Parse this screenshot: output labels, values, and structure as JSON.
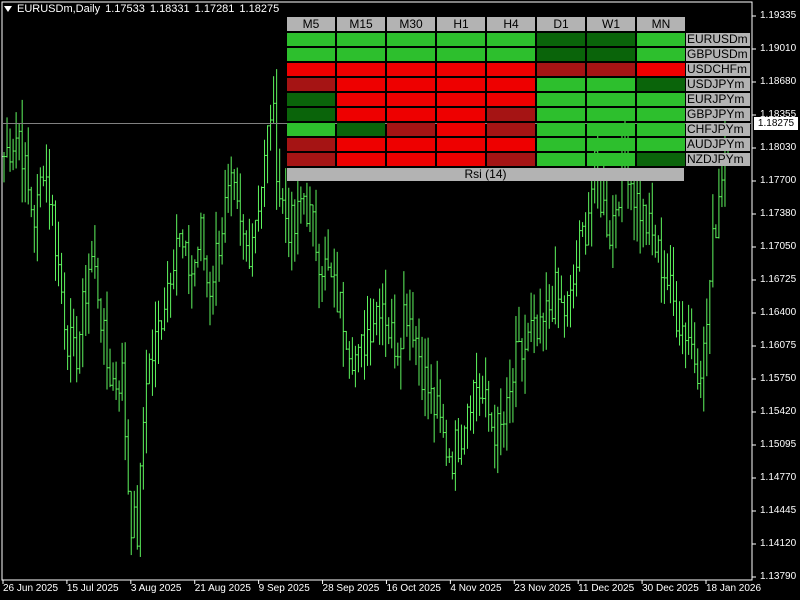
{
  "header": {
    "symbol_tf": "EURUSDm,Daily",
    "open": "1.17533",
    "high": "1.18331",
    "low": "1.17281",
    "close": "1.18275"
  },
  "y_axis": {
    "labels": [
      "1.19335",
      "1.19010",
      "1.18680",
      "1.18355",
      "1.18030",
      "1.17700",
      "1.17380",
      "1.17050",
      "1.16725",
      "1.16400",
      "1.16075",
      "1.15750",
      "1.15420",
      "1.15095",
      "1.14770",
      "1.14445",
      "1.14120",
      "1.13790"
    ],
    "range": [
      1.1379,
      1.19335
    ],
    "current_price": "1.18275",
    "current_price_value": 1.18275
  },
  "x_axis": {
    "labels": [
      "26 Jun 2025",
      "15 Jul 2025",
      "3 Aug 2025",
      "21 Aug 2025",
      "9 Sep 2025",
      "28 Sep 2025",
      "16 Oct 2025",
      "4 Nov 2025",
      "23 Nov 2025",
      "11 Dec 2025",
      "30 Dec 2025",
      "18 Jan 2026"
    ]
  },
  "indicator": {
    "timeframes": [
      "M5",
      "M15",
      "M30",
      "H1",
      "H4",
      "D1",
      "W1",
      "MN"
    ],
    "footer": "Rsi (14)",
    "colors": {
      "G": "#2dbf2d",
      "D": "#0a640a",
      "R": "#ee0000",
      "M": "#a51414"
    },
    "rows": [
      {
        "pair": "EURUSDm",
        "cells": [
          "G",
          "G",
          "G",
          "G",
          "G",
          "D",
          "D",
          "G"
        ]
      },
      {
        "pair": "GBPUSDm",
        "cells": [
          "G",
          "G",
          "G",
          "G",
          "G",
          "D",
          "D",
          "G"
        ]
      },
      {
        "pair": "USDCHFm",
        "cells": [
          "R",
          "R",
          "R",
          "R",
          "R",
          "M",
          "M",
          "R"
        ]
      },
      {
        "pair": "USDJPYm",
        "cells": [
          "M",
          "R",
          "R",
          "R",
          "R",
          "G",
          "G",
          "D"
        ]
      },
      {
        "pair": "EURJPYm",
        "cells": [
          "D",
          "R",
          "R",
          "R",
          "R",
          "G",
          "G",
          "G"
        ]
      },
      {
        "pair": "GBPJPYm",
        "cells": [
          "D",
          "R",
          "R",
          "R",
          "M",
          "G",
          "G",
          "G"
        ]
      },
      {
        "pair": "CHFJPYm",
        "cells": [
          "G",
          "D",
          "M",
          "R",
          "M",
          "G",
          "G",
          "G"
        ]
      },
      {
        "pair": "AUDJPYm",
        "cells": [
          "M",
          "R",
          "R",
          "R",
          "R",
          "G",
          "G",
          "G"
        ]
      },
      {
        "pair": "NZDJPYm",
        "cells": [
          "M",
          "R",
          "R",
          "R",
          "M",
          "G",
          "G",
          "D"
        ]
      }
    ]
  },
  "chart_data": {
    "type": "candlestick",
    "symbol": "EURUSDm",
    "timeframe": "Daily",
    "ylim": [
      1.1379,
      1.19335
    ],
    "bar_color": "#5ef55e",
    "anchor_closes": [
      1.1795,
      1.181,
      1.182,
      1.176,
      1.173,
      1.179,
      1.175,
      1.168,
      1.162,
      1.159,
      1.164,
      1.17,
      1.166,
      1.159,
      1.157,
      1.158,
      1.144,
      1.142,
      1.158,
      1.16,
      1.164,
      1.168,
      1.172,
      1.169,
      1.168,
      1.172,
      1.166,
      1.17,
      1.174,
      1.176,
      1.172,
      1.17,
      1.174,
      1.178,
      1.185,
      1.176,
      1.173,
      1.172,
      1.176,
      1.173,
      1.17,
      1.168,
      1.166,
      1.164,
      1.161,
      1.159,
      1.162,
      1.164,
      1.166,
      1.162,
      1.161,
      1.165,
      1.163,
      1.159,
      1.156,
      1.154,
      1.151,
      1.15,
      1.152,
      1.156,
      1.157,
      1.155,
      1.153,
      1.152,
      1.154,
      1.159,
      1.16,
      1.162,
      1.161,
      1.164,
      1.166,
      1.164,
      1.165,
      1.17,
      1.173,
      1.178,
      1.175,
      1.172,
      1.176,
      1.18,
      1.176,
      1.174,
      1.172,
      1.17,
      1.168,
      1.165,
      1.163,
      1.162,
      1.159,
      1.16,
      1.17,
      1.177,
      1.183
    ]
  }
}
